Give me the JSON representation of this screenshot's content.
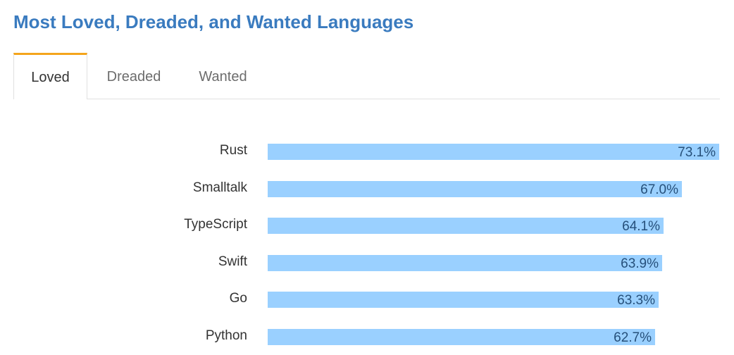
{
  "page": {
    "title": "Most Loved, Dreaded, and Wanted Languages"
  },
  "tabs": [
    {
      "label": "Loved",
      "active": true
    },
    {
      "label": "Dreaded",
      "active": false
    },
    {
      "label": "Wanted",
      "active": false
    }
  ],
  "colors": {
    "title": "#3a7bbf",
    "active_tab_accent": "#f4a51c",
    "bar": "#9ad0ff",
    "value_text": "#26507a"
  },
  "chart_data": {
    "type": "bar",
    "orientation": "horizontal",
    "categories": [
      "Rust",
      "Smalltalk",
      "TypeScript",
      "Swift",
      "Go",
      "Python"
    ],
    "values": [
      73.1,
      67.0,
      64.1,
      63.9,
      63.3,
      62.7
    ],
    "value_labels": [
      "73.1%",
      "67.0%",
      "64.1%",
      "63.9%",
      "63.3%",
      "62.7%"
    ],
    "unit": "%",
    "xlim": [
      0,
      73.1
    ],
    "grid": false
  }
}
